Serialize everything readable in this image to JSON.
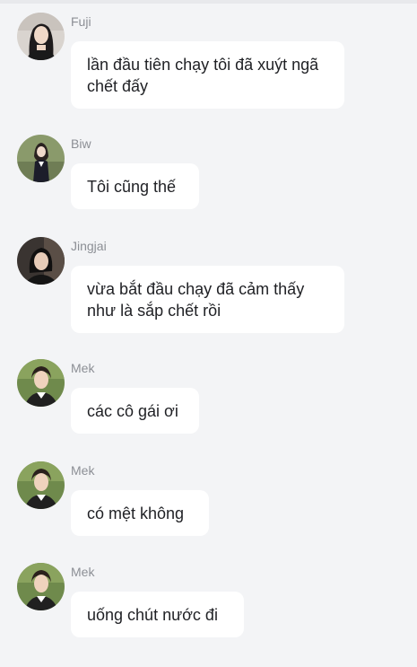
{
  "messages": [
    {
      "sender": "Fuji",
      "avatar_icon": "avatar-fuji-photo",
      "text": "lần đầu tiên chạy tôi đã xuýt ngã chết đấy"
    },
    {
      "sender": "Biw",
      "avatar_icon": "avatar-biw-photo",
      "text": "Tôi cũng thế"
    },
    {
      "sender": "Jingjai",
      "avatar_icon": "avatar-jingjai-photo",
      "text": "vừa bắt đầu chạy đã cảm thấy như là sắp chết rồi"
    },
    {
      "sender": "Mek",
      "avatar_icon": "avatar-mek-photo",
      "text": "các cô gái ơi"
    },
    {
      "sender": "Mek",
      "avatar_icon": "avatar-mek-photo",
      "text": "có mệt không"
    },
    {
      "sender": "Mek",
      "avatar_icon": "avatar-mek-photo",
      "text": "uống chút nước đi"
    }
  ],
  "colors": {
    "background": "#f3f4f6",
    "bubble": "#ffffff",
    "sender_name": "#8c8f95",
    "message_text": "#1f2024"
  }
}
